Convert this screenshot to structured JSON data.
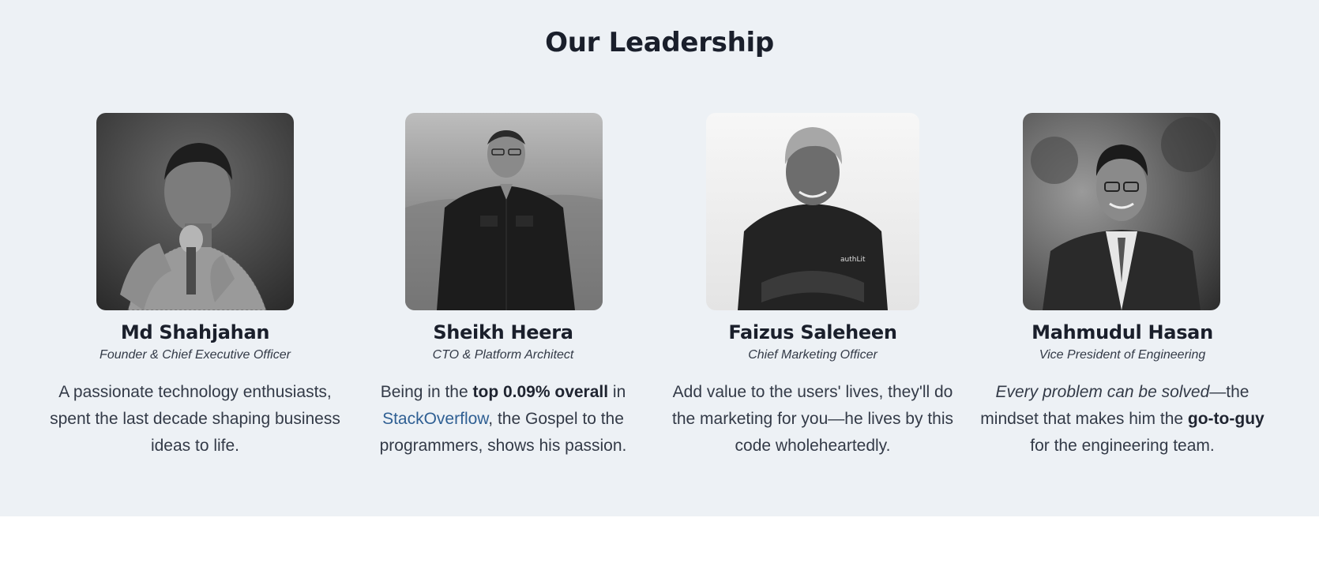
{
  "section": {
    "title": "Our Leadership"
  },
  "members": [
    {
      "name": "Md Shahjahan",
      "role": "Founder & Chief Executive Officer",
      "bio": {
        "text": "A passionate technology enthusiasts, spent the last decade shaping business ideas to life."
      }
    },
    {
      "name": "Sheikh Heera",
      "role": "CTO & Platform Architect",
      "bio": {
        "part1": "Being in the ",
        "bold": "top 0.09% overall",
        "part2": " in ",
        "link": "StackOverflow",
        "part3": ", the Gospel to the programmers, shows his passion."
      }
    },
    {
      "name": "Faizus Saleheen",
      "role": "Chief Marketing Officer",
      "bio": {
        "text": "Add value to the users' lives, they'll do the marketing for you—he lives by this code wholeheartedly."
      },
      "shirt_logo": "authLit"
    },
    {
      "name": "Mahmudul Hasan",
      "role": "Vice President of Engineering",
      "bio": {
        "italic": "Every problem can be solved",
        "part1": "—the mindset that makes him the ",
        "bold": "go-to-guy",
        "part2": " for the engineering team."
      }
    }
  ],
  "colors": {
    "section_bg": "#edf1f5",
    "heading": "#1a1f2b",
    "body_text": "#333a47",
    "link": "#2f5f93"
  }
}
